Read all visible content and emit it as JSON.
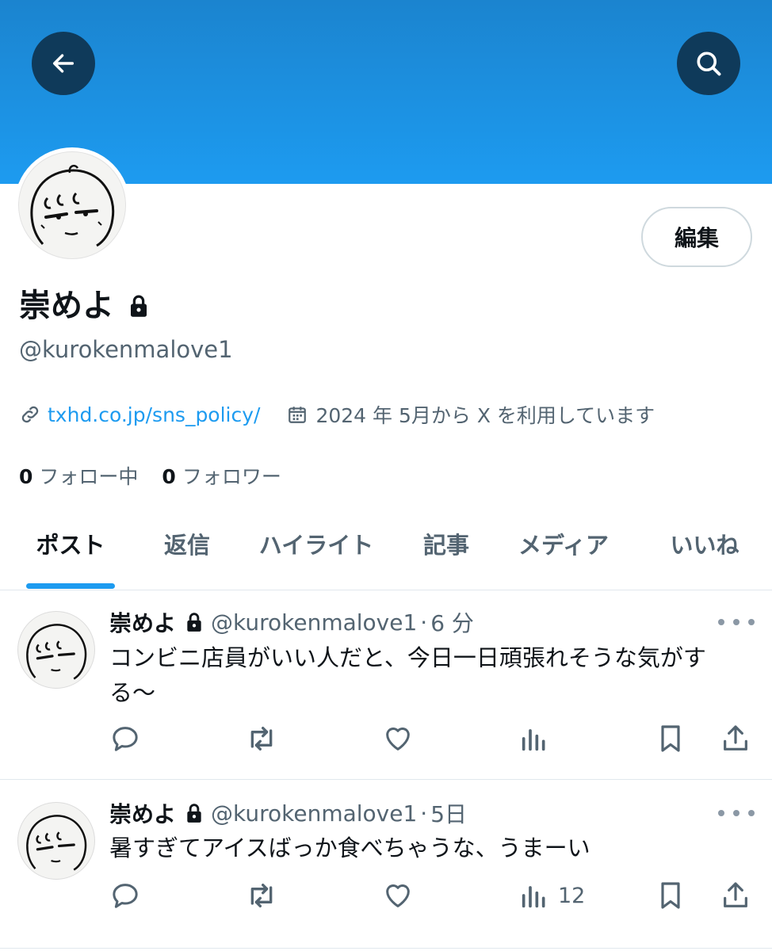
{
  "header": {
    "back_icon": "arrow-left-icon",
    "search_icon": "search-icon"
  },
  "profile": {
    "display_name": "崇めよ",
    "handle": "@kurokenmalove1",
    "edit_label": "編集",
    "website": "txhd.co.jp/sns_policy/",
    "joined": "2024 年 5月から X を利用しています",
    "following_count": "0",
    "following_label": "フォロー中",
    "followers_count": "0",
    "followers_label": "フォロワー"
  },
  "tabs": [
    {
      "label": "ポスト",
      "active": true
    },
    {
      "label": "返信"
    },
    {
      "label": "ハイライト"
    },
    {
      "label": "記事"
    },
    {
      "label": "メディア"
    },
    {
      "label": "いいね"
    }
  ],
  "posts": [
    {
      "name": "崇めよ",
      "handle": "@kurokenmalove1",
      "separator": "·",
      "time": "6 分",
      "text": "コンビニ店員がいい人だと、今日一日頑張れそうな気がする〜",
      "views": ""
    },
    {
      "name": "崇めよ",
      "handle": "@kurokenmalove1",
      "separator": "·",
      "time": "5日",
      "text": "暑すぎてアイスばっか食べちゃうな、うまーい",
      "views": "12"
    }
  ],
  "colors": {
    "accent": "#1d9bf0",
    "banner_top": "#1b84cf",
    "button_dark": "#0f3a5a",
    "muted": "#536471"
  }
}
